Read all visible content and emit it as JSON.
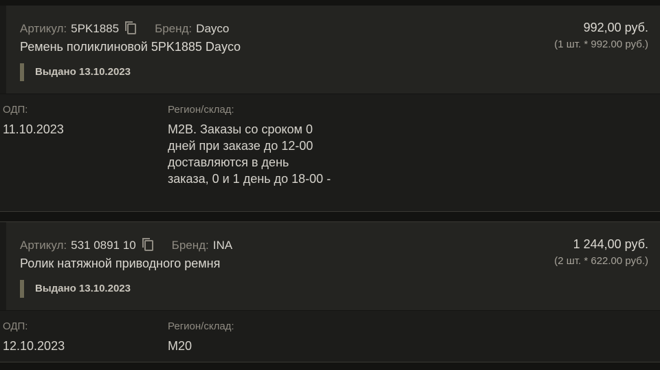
{
  "orders": [
    {
      "article_label": "Артикул:",
      "article_value": "5PK1885",
      "brand_label": "Бренд:",
      "brand_value": "Dayco",
      "product_name": "Ремень поликлиновой 5PK1885 Dayco",
      "status": "Выдано 13.10.2023",
      "price": "992,00 руб.",
      "price_detail": "(1 шт. * 992.00 руб.)",
      "odp_label": "ОДП:",
      "odp_value": "11.10.2023",
      "region_label": "Регион/склад:",
      "region_value": "M2B. Заказы со сроком 0 дней при заказе до 12-00 доставляются в день заказа, 0 и 1 день до 18-00 -"
    },
    {
      "article_label": "Артикул:",
      "article_value": "531 0891 10",
      "brand_label": "Бренд:",
      "brand_value": "INA",
      "product_name": "Ролик натяжной приводного ремня",
      "status": "Выдано 13.10.2023",
      "price": "1 244,00 руб.",
      "price_detail": "(2 шт. * 622.00 руб.)",
      "odp_label": "ОДП:",
      "odp_value": "12.10.2023",
      "region_label": "Регион/склад:",
      "region_value": "M20"
    }
  ],
  "icons": {
    "copy": "copy-icon"
  },
  "colors": {
    "background": "#131311",
    "card": "#1c1c1a",
    "card_header": "#242421",
    "status_bar": "#6e6a55",
    "muted_text": "#8f8b82"
  }
}
